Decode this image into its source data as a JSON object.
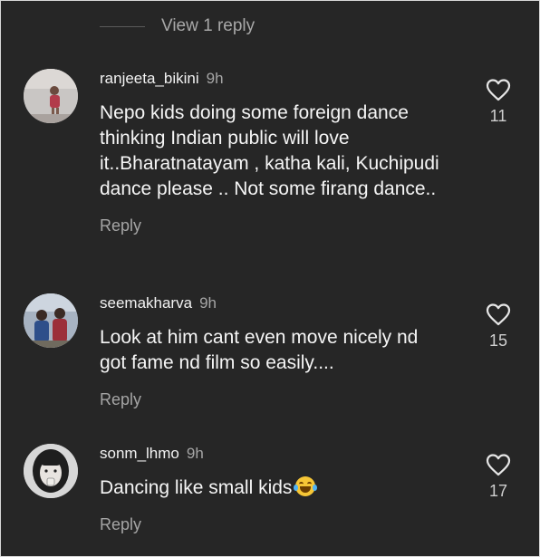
{
  "thread": {
    "view_replies_label": "View 1 reply"
  },
  "comments": [
    {
      "username": "ranjeeta_bikini",
      "time": "9h",
      "text": "Nepo kids doing some foreign dance thinking Indian public will love it..Bharatnatayam , katha kali, Kuchipudi dance please .. Not some firang dance..",
      "reply_label": "Reply",
      "likes": "11"
    },
    {
      "username": "seemakharva",
      "time": "9h",
      "text": "Look at him cant even move nicely nd got fame nd film so easily....",
      "reply_label": "Reply",
      "likes": "15"
    },
    {
      "username": "sonm_lhmo",
      "time": "9h",
      "text": "Dancing like small kids",
      "emoji": "face-with-tears-of-joy-icon",
      "reply_label": "Reply",
      "likes": "17"
    }
  ],
  "colors": {
    "background": "#262626",
    "text": "#f5f5f5",
    "muted": "#a5a5a5"
  }
}
